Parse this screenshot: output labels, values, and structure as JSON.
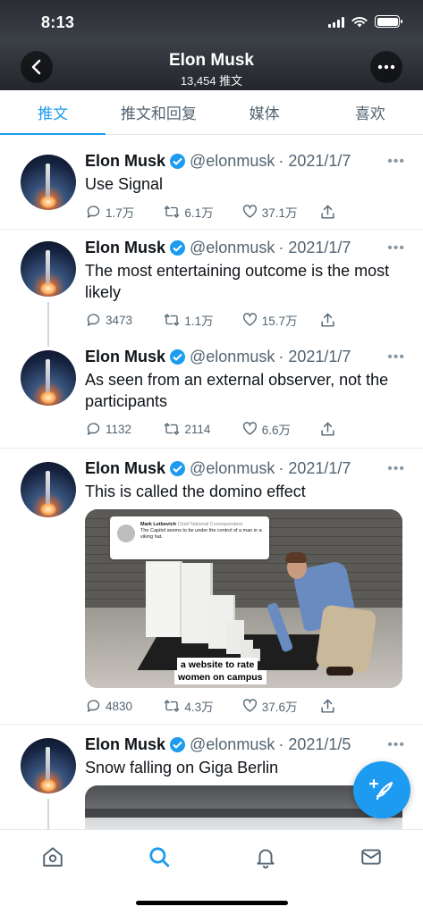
{
  "status": {
    "time": "8:13"
  },
  "header": {
    "title": "Elon Musk",
    "subtitle": "13,454 推文"
  },
  "tabs": [
    {
      "label": "推文",
      "active": true
    },
    {
      "label": "推文和回复",
      "active": false
    },
    {
      "label": "媒体",
      "active": false
    },
    {
      "label": "喜欢",
      "active": false
    }
  ],
  "tweets": [
    {
      "name": "Elon Musk",
      "handle": "@elonmusk",
      "date": "· 2021/1/7",
      "text": "Use Signal",
      "replies": "1.7万",
      "retweets": "6.1万",
      "likes": "37.1万"
    },
    {
      "name": "Elon Musk",
      "handle": "@elonmusk",
      "date": "· 2021/1/7",
      "text": "The most entertaining outcome is the most likely",
      "replies": "3473",
      "retweets": "1.1万",
      "likes": "15.7万"
    },
    {
      "name": "Elon Musk",
      "handle": "@elonmusk",
      "date": "· 2021/1/7",
      "text": "As seen from an external observer, not the participants",
      "replies": "1132",
      "retweets": "2114",
      "likes": "6.6万"
    },
    {
      "name": "Elon Musk",
      "handle": "@elonmusk",
      "date": "· 2021/1/7",
      "text": "This is called the domino effect",
      "replies": "4830",
      "retweets": "4.3万",
      "likes": "37.6万",
      "media": {
        "quote_author": "Mark Leibovich",
        "quote_role": "Chief National Correspondent",
        "quote_text": "The Capitol seems to be under the control of a man in a viking hat.",
        "caption_line1": "a website to rate",
        "caption_line2": "women on campus"
      }
    },
    {
      "name": "Elon Musk",
      "handle": "@elonmusk",
      "date": "· 2021/1/5",
      "text": "Snow falling on Giga Berlin"
    }
  ],
  "menu_glyph": "•••"
}
